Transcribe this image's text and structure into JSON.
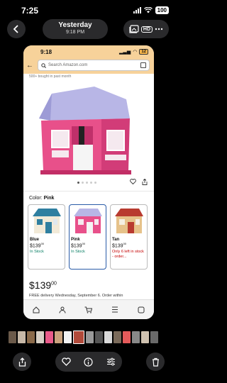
{
  "status": {
    "time": "7:25",
    "battery": "100"
  },
  "header": {
    "title": "Yesterday",
    "subtitle": "9:18 PM",
    "hd_badge": "HD"
  },
  "phone": {
    "time": "9:18",
    "battery": "12",
    "search_placeholder": "Search Amazon.com",
    "bought_text": "500+ bought in past month",
    "color_label": "Color:",
    "color_value": "Pink",
    "options": [
      {
        "name": "Blue",
        "price_whole": "$139",
        "price_cents": "00",
        "stock": "In Stock",
        "color": "#2f7fa0"
      },
      {
        "name": "Pink",
        "price_whole": "$139",
        "price_cents": "00",
        "stock": "In Stock",
        "color": "#e8508a"
      },
      {
        "name": "Tan",
        "price_whole": "$139",
        "price_cents": "00",
        "stock": "Only 6 left in stock - order...",
        "color": "#b83a2f"
      }
    ],
    "price_whole": "$139",
    "price_cents": "00",
    "delivery": "FREE delivery Wednesday, September 6. Order within"
  },
  "icons": {
    "back": "chevron-left-icon",
    "gallery": "photo-gallery-icon",
    "share": "share-icon",
    "heart": "heart-icon",
    "info": "info-icon",
    "adjust": "adjust-icon",
    "trash": "trash-icon"
  },
  "thumbnails": [
    "#6b5a4a",
    "#c7b9a8",
    "#8a6a4a",
    "#d7d0c6",
    "#e85b8a",
    "#caa37e",
    "#f2f2f2",
    "#b14a3a",
    "#999999",
    "#555555",
    "#dadada",
    "#7a6a5a",
    "#e45b5b",
    "#888888",
    "#cfc2b0",
    "#6a6a6a"
  ],
  "selected_thumb_index": 7
}
